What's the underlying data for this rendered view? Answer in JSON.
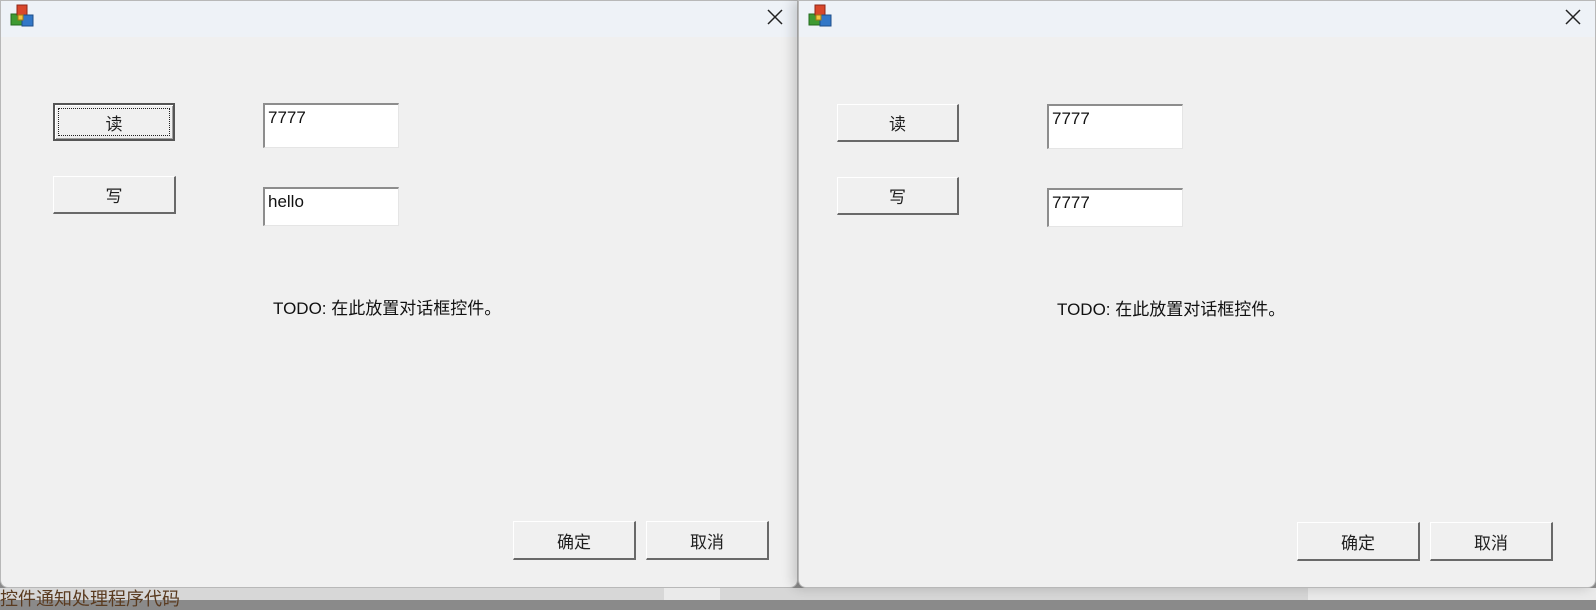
{
  "background": {
    "partial_text": "控件通知处理程序代码"
  },
  "dialogs": [
    {
      "icon": "app-blocks-icon",
      "read_button": "读",
      "write_button": "写",
      "read_field_value": "7777",
      "write_field_value": "hello",
      "todo_text": "TODO: 在此放置对话框控件。",
      "ok_button": "确定",
      "cancel_button": "取消"
    },
    {
      "icon": "app-blocks-icon",
      "read_button": "读",
      "write_button": "写",
      "read_field_value": "7777",
      "write_field_value": "7777",
      "todo_text": "TODO: 在此放置对话框控件。",
      "ok_button": "确定",
      "cancel_button": "取消"
    }
  ],
  "colors": {
    "dialog_bg": "#f0f0f0",
    "titlebar_bg": "#eef2f7"
  }
}
